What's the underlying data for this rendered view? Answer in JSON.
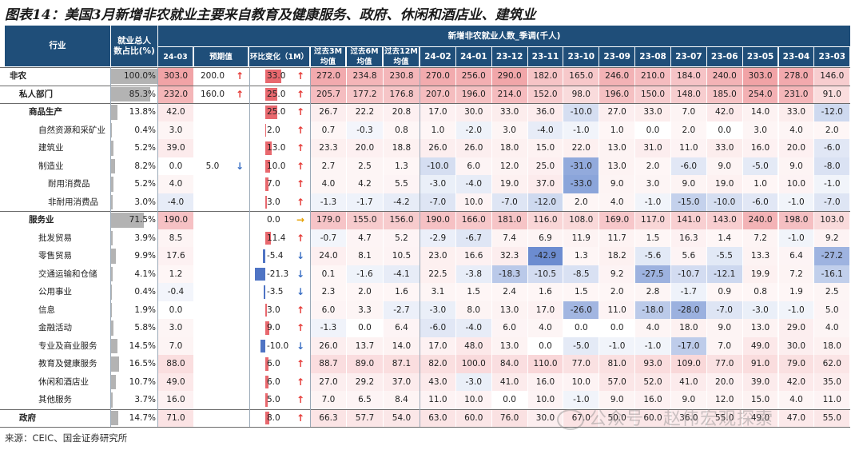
{
  "title": "图表14：美国3月新增非农就业主要来自教育及健康服务、政府、休闲和酒店业、建筑业",
  "footer": "来源：CEIC、国金证券研究所",
  "watermark": "公众号 · 赵伟宏观探索",
  "colors": {
    "header": "#1f4e79",
    "red": "#e8686e",
    "blue": "#4f74c4",
    "share": "#b3b3b3"
  },
  "headers": {
    "industry": "行业",
    "share": "就业总人数占比(%)",
    "group": "新增非农就业人数_季调(千人)",
    "actual": "24-03",
    "forecast": "预期值",
    "mom": "环比变化（1M）",
    "avg3": "过去3M均值",
    "avg6": "过去6M均值",
    "avg12": "过去12M均值",
    "months": [
      "24-02",
      "24-01",
      "23-12",
      "23-11",
      "23-10",
      "23-09",
      "23-08",
      "23-07",
      "23-06",
      "23-05",
      "23-04",
      "23-03"
    ]
  },
  "rows": [
    {
      "label": "非农",
      "indent": 0,
      "bold": true,
      "share": "100.0%",
      "actual": "303.0",
      "forecast": "200.0",
      "forecast_arrow": "up",
      "mom": "33.0",
      "mom_arrow": "up",
      "avg3": "272.0",
      "avg6": "234.8",
      "avg12": "230.8",
      "months": [
        "270.0",
        "256.0",
        "290.0",
        "182.0",
        "165.0",
        "246.0",
        "210.0",
        "184.0",
        "240.0",
        "303.0",
        "278.0",
        "146.0"
      ]
    },
    {
      "label": "私人部门",
      "indent": 1,
      "bold": true,
      "share": "85.3%",
      "actual": "232.0",
      "forecast": "160.0",
      "forecast_arrow": "up",
      "mom": "25.0",
      "mom_arrow": "up",
      "avg3": "205.7",
      "avg6": "177.2",
      "avg12": "176.8",
      "months": [
        "207.0",
        "196.0",
        "214.0",
        "152.0",
        "98.0",
        "196.0",
        "150.0",
        "148.0",
        "185.0",
        "254.0",
        "231.0",
        "91.0"
      ]
    },
    {
      "label": "商品生产",
      "indent": 2,
      "bold": true,
      "share": "13.8%",
      "actual": "42.0",
      "forecast": "",
      "forecast_arrow": "",
      "mom": "25.0",
      "mom_arrow": "up",
      "avg3": "26.7",
      "avg6": "22.2",
      "avg12": "20.8",
      "months": [
        "17.0",
        "30.0",
        "33.0",
        "36.0",
        "-10.0",
        "27.0",
        "33.0",
        "7.0",
        "42.0",
        "14.0",
        "33.0",
        "-12.0"
      ]
    },
    {
      "label": "自然资源和采矿业",
      "indent": 3,
      "bold": false,
      "share": "0.4%",
      "actual": "3.0",
      "forecast": "",
      "forecast_arrow": "",
      "mom": "2.0",
      "mom_arrow": "up",
      "avg3": "0.7",
      "avg6": "-0.3",
      "avg12": "0.8",
      "months": [
        "1.0",
        "-2.0",
        "3.0",
        "-4.0",
        "-1.0",
        "1.0",
        "0.0",
        "2.0",
        "0.0",
        "3.0",
        "4.0",
        "2.0"
      ]
    },
    {
      "label": "建筑业",
      "indent": 3,
      "bold": false,
      "share": "5.2%",
      "actual": "39.0",
      "forecast": "",
      "forecast_arrow": "",
      "mom": "13.0",
      "mom_arrow": "up",
      "avg3": "23.3",
      "avg6": "20.0",
      "avg12": "18.8",
      "months": [
        "26.0",
        "26.0",
        "18.0",
        "15.0",
        "22.0",
        "13.0",
        "31.0",
        "11.0",
        "33.0",
        "16.0",
        "20.0",
        "-6.0"
      ]
    },
    {
      "label": "制造业",
      "indent": 3,
      "bold": false,
      "share": "8.2%",
      "actual": "0.0",
      "forecast": "5.0",
      "forecast_arrow": "down",
      "mom": "10.0",
      "mom_arrow": "up",
      "avg3": "2.7",
      "avg6": "2.5",
      "avg12": "1.3",
      "months": [
        "-10.0",
        "6.0",
        "12.0",
        "25.0",
        "-31.0",
        "13.0",
        "2.0",
        "-6.0",
        "9.0",
        "-5.0",
        "9.0",
        "-8.0"
      ]
    },
    {
      "label": "耐用消费品",
      "indent": 4,
      "bold": false,
      "share": "5.2%",
      "actual": "4.0",
      "forecast": "",
      "forecast_arrow": "",
      "mom": "7.0",
      "mom_arrow": "up",
      "avg3": "4.0",
      "avg6": "4.2",
      "avg12": "5.5",
      "months": [
        "-3.0",
        "-4.0",
        "19.0",
        "37.0",
        "-33.0",
        "9.0",
        "3.0",
        "9.0",
        "19.0",
        "1.0",
        "10.0",
        "-1.0"
      ]
    },
    {
      "label": "非耐用消费品",
      "indent": 4,
      "bold": false,
      "share": "3.0%",
      "actual": "-4.0",
      "forecast": "",
      "forecast_arrow": "",
      "mom": "3.0",
      "mom_arrow": "up",
      "avg3": "-1.3",
      "avg6": "-1.7",
      "avg12": "-4.2",
      "months": [
        "-7.0",
        "10.0",
        "-7.0",
        "-12.0",
        "2.0",
        "4.0",
        "-1.0",
        "-15.0",
        "-10.0",
        "-6.0",
        "-1.0",
        "-7.0"
      ]
    },
    {
      "label": "服务业",
      "indent": 2,
      "bold": true,
      "share": "71.5%",
      "actual": "190.0",
      "forecast": "",
      "forecast_arrow": "",
      "mom": "0.0",
      "mom_arrow": "flat",
      "avg3": "179.0",
      "avg6": "155.0",
      "avg12": "156.0",
      "months": [
        "190.0",
        "166.0",
        "181.0",
        "116.0",
        "108.0",
        "169.0",
        "117.0",
        "141.0",
        "143.0",
        "240.0",
        "198.0",
        "103.0"
      ]
    },
    {
      "label": "批发贸易",
      "indent": 3,
      "bold": false,
      "share": "3.9%",
      "actual": "8.5",
      "forecast": "",
      "forecast_arrow": "",
      "mom": "11.4",
      "mom_arrow": "up",
      "avg3": "-0.7",
      "avg6": "4.7",
      "avg12": "5.2",
      "months": [
        "-2.9",
        "-6.7",
        "7.4",
        "6.9",
        "11.9",
        "11.7",
        "1.5",
        "16.3",
        "1.4",
        "7.2",
        "-1.0",
        "9.2"
      ]
    },
    {
      "label": "零售贸易",
      "indent": 3,
      "bold": false,
      "share": "9.9%",
      "actual": "17.6",
      "forecast": "",
      "forecast_arrow": "",
      "mom": "-5.4",
      "mom_arrow": "down",
      "avg3": "24.0",
      "avg6": "8.1",
      "avg12": "10.5",
      "months": [
        "23.0",
        "16.6",
        "32.3",
        "-42.9",
        "1.3",
        "18.2",
        "-5.6",
        "5.6",
        "-5.5",
        "13.3",
        "6.4",
        "-27.2"
      ]
    },
    {
      "label": "交通运输和仓储",
      "indent": 3,
      "bold": false,
      "share": "4.1%",
      "actual": "1.2",
      "forecast": "",
      "forecast_arrow": "",
      "mom": "-21.3",
      "mom_arrow": "down",
      "avg3": "0.1",
      "avg6": "-1.6",
      "avg12": "-4.1",
      "months": [
        "22.5",
        "-3.8",
        "-18.3",
        "-10.5",
        "-8.5",
        "9.2",
        "-27.5",
        "-10.7",
        "-12.1",
        "19.9",
        "7.2",
        "-16.1"
      ]
    },
    {
      "label": "公用事业",
      "indent": 3,
      "bold": false,
      "share": "0.4%",
      "actual": "-0.4",
      "forecast": "",
      "forecast_arrow": "",
      "mom": "-3.5",
      "mom_arrow": "down",
      "avg3": "2.3",
      "avg6": "2.0",
      "avg12": "1.6",
      "months": [
        "3.1",
        "1.5",
        "2.4",
        "1.6",
        "1.5",
        "2.0",
        "2.8",
        "-1.7",
        "0.9",
        "0.8",
        "1.9",
        "2.5"
      ]
    },
    {
      "label": "信息",
      "indent": 3,
      "bold": false,
      "share": "1.9%",
      "actual": "0.0",
      "forecast": "",
      "forecast_arrow": "",
      "mom": "3.0",
      "mom_arrow": "up",
      "avg3": "6.0",
      "avg6": "3.3",
      "avg12": "-2.7",
      "months": [
        "-3.0",
        "8.0",
        "13.0",
        "17.0",
        "-26.0",
        "11.0",
        "-18.0",
        "-28.0",
        "-7.0",
        "-3.0",
        "-1.0",
        "5.0"
      ]
    },
    {
      "label": "金融活动",
      "indent": 3,
      "bold": false,
      "share": "5.8%",
      "actual": "3.0",
      "forecast": "",
      "forecast_arrow": "",
      "mom": "9.0",
      "mom_arrow": "up",
      "avg3": "-1.3",
      "avg6": "0.0",
      "avg12": "6.4",
      "months": [
        "-6.0",
        "-4.0",
        "6.0",
        "4.0",
        "0.0",
        "0.0",
        "4.0",
        "18.0",
        "9.0",
        "13.0",
        "29.0",
        "4.0"
      ]
    },
    {
      "label": "专业及商业服务",
      "indent": 3,
      "bold": false,
      "share": "14.5%",
      "actual": "7.0",
      "forecast": "",
      "forecast_arrow": "",
      "mom": "-10.0",
      "mom_arrow": "down",
      "avg3": "26.0",
      "avg6": "13.7",
      "avg12": "14.0",
      "months": [
        "17.0",
        "48.0",
        "13.0",
        "0.0",
        "-5.0",
        "-1.0",
        "-1.0",
        "-17.0",
        "7.0",
        "49.0",
        "30.0",
        "18.0"
      ]
    },
    {
      "label": "教育及健康服务",
      "indent": 3,
      "bold": false,
      "share": "16.5%",
      "actual": "88.0",
      "forecast": "",
      "forecast_arrow": "",
      "mom": "6.0",
      "mom_arrow": "up",
      "avg3": "88.7",
      "avg6": "89.0",
      "avg12": "87.1",
      "months": [
        "82.0",
        "100.0",
        "84.0",
        "110.0",
        "77.0",
        "81.0",
        "93.0",
        "109.0",
        "77.0",
        "91.0",
        "79.0",
        "62.0"
      ]
    },
    {
      "label": "休闲和酒店业",
      "indent": 3,
      "bold": false,
      "share": "10.7%",
      "actual": "49.0",
      "forecast": "",
      "forecast_arrow": "",
      "mom": "6.0",
      "mom_arrow": "up",
      "avg3": "27.0",
      "avg6": "29.2",
      "avg12": "37.0",
      "months": [
        "43.0",
        "-3.0",
        "41.0",
        "16.0",
        "10.0",
        "57.0",
        "52.0",
        "41.0",
        "20.0",
        "39.0",
        "42.0",
        "35.0"
      ]
    },
    {
      "label": "其他服务",
      "indent": 3,
      "bold": false,
      "share": "3.7%",
      "actual": "16.0",
      "forecast": "",
      "forecast_arrow": "",
      "mom": "5.0",
      "mom_arrow": "up",
      "avg3": "7.0",
      "avg6": "6.5",
      "avg12": "8.4",
      "months": [
        "11.0",
        "10.0",
        "0.0",
        "10.0",
        "-1.0",
        "9.0",
        "16.0",
        "9.0",
        "12.0",
        "15.0",
        "4.0",
        "11.0"
      ]
    },
    {
      "label": "政府",
      "indent": 1,
      "bold": true,
      "share": "14.7%",
      "actual": "71.0",
      "forecast": "",
      "forecast_arrow": "",
      "mom": "8.0",
      "mom_arrow": "up",
      "avg3": "66.3",
      "avg6": "57.7",
      "avg12": "54.0",
      "months": [
        "63.0",
        "60.0",
        "76.0",
        "30.0",
        "67.0",
        "50.0",
        "60.0",
        "36.0",
        "55.0",
        "49.0",
        "47.0",
        "55.0"
      ]
    }
  ]
}
